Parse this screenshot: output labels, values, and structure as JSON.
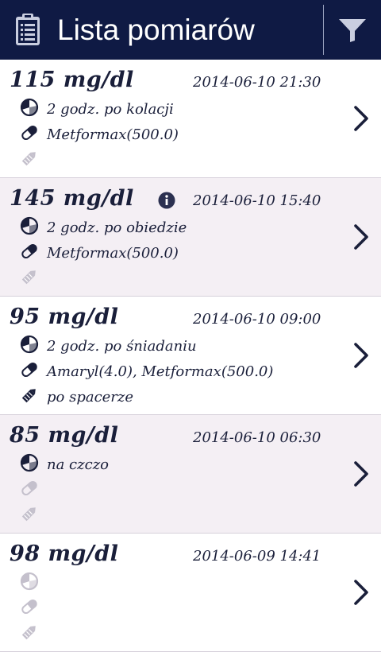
{
  "header": {
    "title": "Lista pomiarów",
    "icons": {
      "app": "clipboard-icon",
      "filter": "filter-icon"
    },
    "background": "#0f1a44"
  },
  "colors": {
    "accent": "#1a1f3a",
    "alt_row": "#f4eff4",
    "disabled": "#c4c0cc"
  },
  "measurements": [
    {
      "value": "115 mg/dl",
      "datetime": "2014-06-10 21:30",
      "meal": "2 godz. po kolacji",
      "medication": "Metformax(500.0)",
      "note": "",
      "info": false
    },
    {
      "value": "145 mg/dl",
      "datetime": "2014-06-10 15:40",
      "meal": "2 godz. po obiedzie",
      "medication": "Metformax(500.0)",
      "note": "",
      "info": true
    },
    {
      "value": "95 mg/dl",
      "datetime": "2014-06-10 09:00",
      "meal": "2 godz. po śniadaniu",
      "medication": "Amaryl(4.0), Metformax(500.0)",
      "note": "po spacerze",
      "info": false
    },
    {
      "value": "85 mg/dl",
      "datetime": "2014-06-10 06:30",
      "meal": "na czczo",
      "medication": "",
      "note": "",
      "info": false
    },
    {
      "value": "98 mg/dl",
      "datetime": "2014-06-09 14:41",
      "meal": "",
      "medication": "",
      "note": "",
      "info": false
    }
  ]
}
